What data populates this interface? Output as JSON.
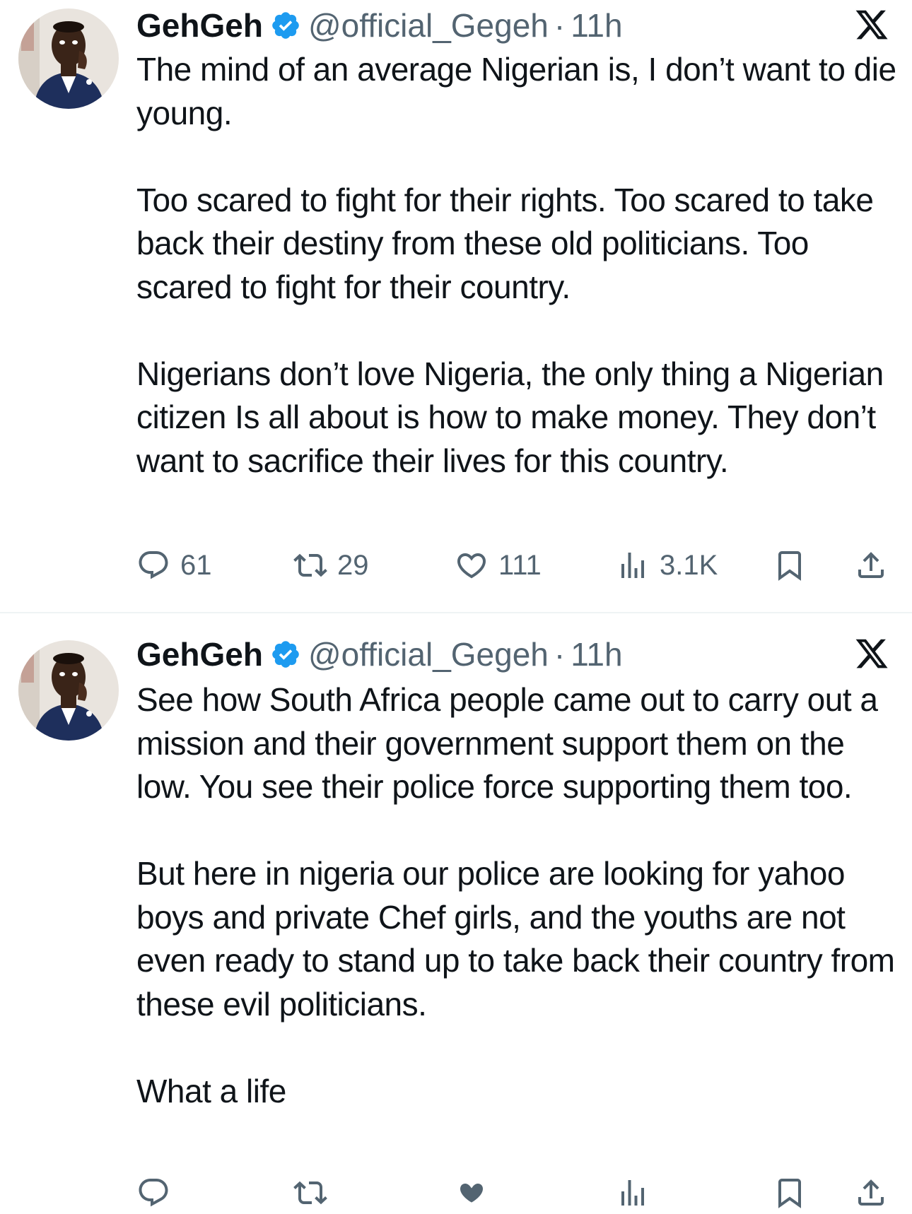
{
  "tweets": [
    {
      "author": {
        "name": "GehGeh",
        "handle": "@official_Gegeh",
        "verified_icon": "verified-badge-icon",
        "verified_color": "#1d9bf0"
      },
      "separator": "·",
      "time": "11h",
      "paragraphs": [
        "The mind of an average Nigerian is, I don’t want to die young.",
        "Too scared to fight for their rights. Too scared to take back their destiny from these old politicians. Too scared to fight for their country.",
        "Nigerians don’t love Nigeria, the only thing a Nigerian citizen Is all about is how to make money. They don’t want to sacrifice their lives for this country."
      ],
      "actions": {
        "replies": "61",
        "reposts": "29",
        "likes": "111",
        "views": "3.1K"
      }
    },
    {
      "author": {
        "name": "GehGeh",
        "handle": "@official_Gegeh",
        "verified_icon": "verified-badge-icon",
        "verified_color": "#1d9bf0"
      },
      "separator": "·",
      "time": "11h",
      "paragraphs": [
        "See how South Africa people came out to carry out a mission and their government support them on the low. You see their police force supporting them too.",
        "But here in nigeria our police are looking for yahoo boys and private Chef girls, and the youths are not even ready to stand up to take back their country from these evil politicians.",
        "What a life"
      ]
    }
  ],
  "colors": {
    "text": "#0f1419",
    "secondary": "#536471",
    "accent": "#1d9bf0",
    "divider": "#eff3f4"
  }
}
